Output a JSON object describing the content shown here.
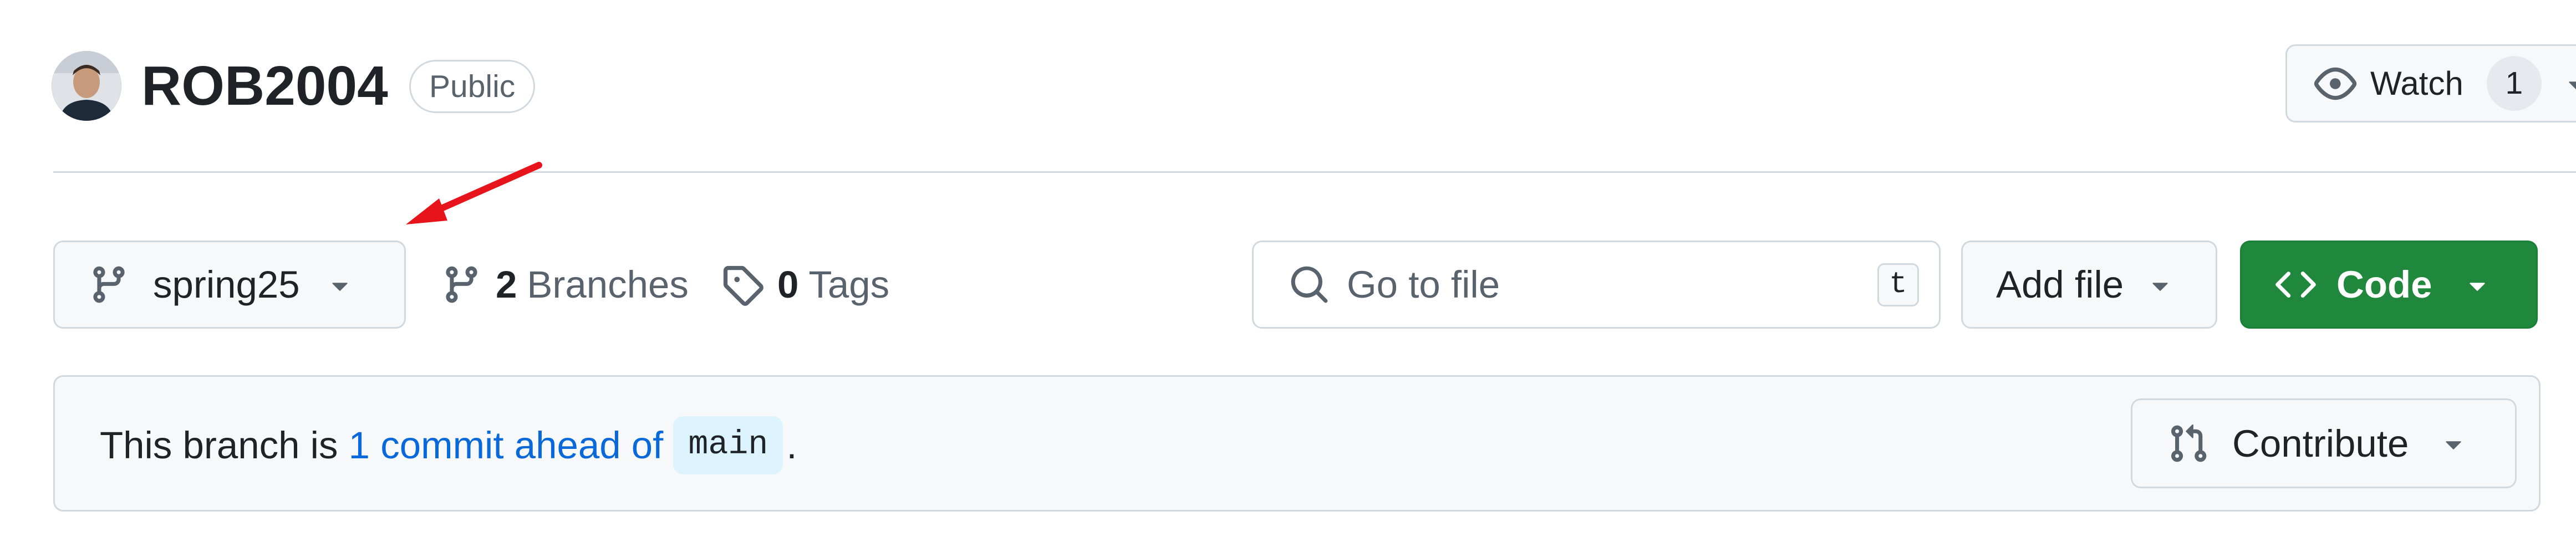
{
  "repo": {
    "name": "ROB2004",
    "visibility": "Public"
  },
  "watch": {
    "label": "Watch",
    "count": "1"
  },
  "toolbar": {
    "branch": "spring25",
    "branches_count": "2",
    "branches_label": "Branches",
    "tags_count": "0",
    "tags_label": "Tags",
    "search_placeholder": "Go to file",
    "search_shortcut": "t",
    "add_file_label": "Add file",
    "code_label": "Code"
  },
  "banner": {
    "prefix": "This branch is ",
    "link": "1 commit ahead of",
    "base_branch": "main",
    "suffix": ".",
    "contribute_label": "Contribute"
  },
  "icons": {
    "avatar": "user-avatar",
    "watch": "eye-icon",
    "branch": "git-branch-icon",
    "tag": "tag-icon",
    "search": "search-icon",
    "code": "code-icon",
    "contribute": "git-pull-request-icon",
    "dropdown": "triangle-down-icon"
  },
  "colors": {
    "primary_button": "#1f883d",
    "link": "#0969da",
    "annotation_arrow": "#e8141c"
  }
}
